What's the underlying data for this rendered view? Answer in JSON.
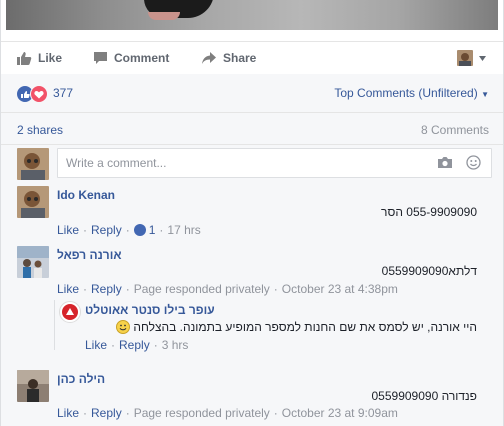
{
  "actions": {
    "like": "Like",
    "comment": "Comment",
    "share": "Share"
  },
  "reactions": {
    "count": "377",
    "filter": "Top Comments (Unfiltered)"
  },
  "stats": {
    "shares": "2 shares",
    "comments": "8 Comments"
  },
  "composer": {
    "placeholder": "Write a comment..."
  },
  "comments": [
    {
      "author": "Ido Kenan",
      "text": "055-9909090 הסר",
      "like": "Like",
      "reply": "Reply",
      "like_count": "1",
      "time": "17 hrs"
    },
    {
      "author": "אורנה רפאל",
      "text": "דלתא0559909090",
      "like": "Like",
      "reply": "Reply",
      "status": "Page responded privately",
      "time": "October 23 at 4:38pm"
    },
    {
      "author": "עופר בילו סנטר אאוטלט",
      "text": "היי אורנה, יש לסמס את שם החנות למספר המופיע בתמונה. בהצלחה",
      "like": "Like",
      "reply": "Reply",
      "time": "3 hrs"
    },
    {
      "author": "הילה כהן",
      "text": "פנדורה 0559909090",
      "like": "Like",
      "reply": "Reply",
      "status": "Page responded privately",
      "time": "October 23 at 9:09am"
    }
  ],
  "colors": {
    "link": "#365899",
    "muted": "#90949c",
    "like_blue": "#4267b2",
    "love_red": "#f25268"
  }
}
